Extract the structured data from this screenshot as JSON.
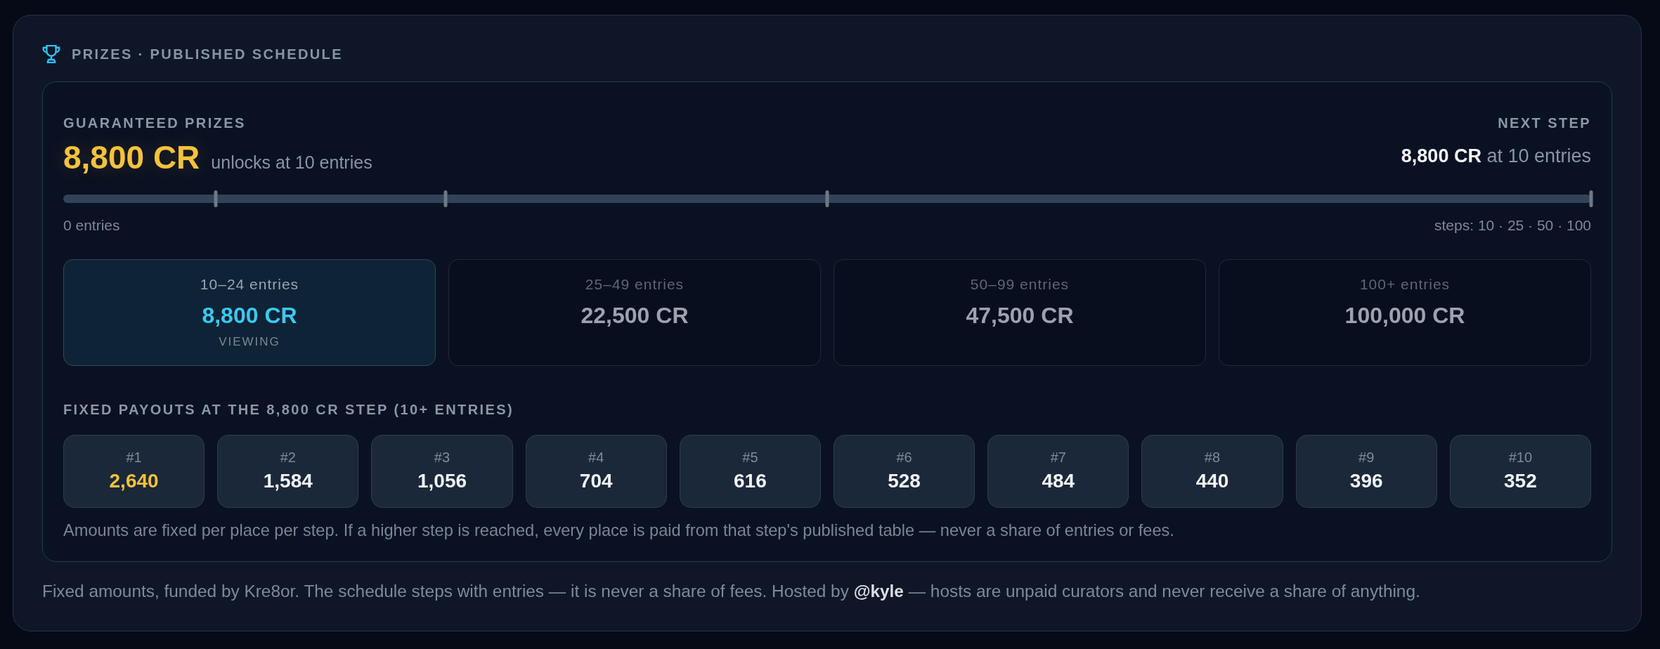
{
  "header": {
    "title": "PRIZES · PUBLISHED SCHEDULE"
  },
  "guaranteed": {
    "label": "GUARANTEED PRIZES",
    "amount": "8,800 CR",
    "note": "unlocks at 10 entries"
  },
  "next_step": {
    "label": "NEXT STEP",
    "text": "**8,800 CR** at 10 entries"
  },
  "progress": {
    "markers": [
      {
        "level": 0.1
      },
      {
        "level": 0.25
      },
      {
        "level": 0.5
      },
      {
        "level": 1
      }
    ],
    "start_label": "0 entries",
    "steps_label": "steps: 10 · 25 · 50 · 100"
  },
  "tiers": [
    {
      "range": "10–24 entries",
      "amount": "8,800 CR",
      "selected": true,
      "badge": "VIEWING"
    },
    {
      "range": "25–49 entries",
      "amount": "22,500 CR",
      "selected": false
    },
    {
      "range": "50–99 entries",
      "amount": "47,500 CR",
      "selected": false
    },
    {
      "range": "100+ entries",
      "amount": "100,000 CR",
      "selected": false
    }
  ],
  "payouts": {
    "title": "FIXED PAYOUTS AT THE 8,800 CR STEP (10+ ENTRIES)",
    "places": [
      {
        "place": "#1",
        "amount": "2,640",
        "highlighted": true
      },
      {
        "place": "#2",
        "amount": "1,584",
        "highlighted": false
      },
      {
        "place": "#3",
        "amount": "1,056",
        "highlighted": false
      },
      {
        "place": "#4",
        "amount": "704",
        "highlighted": false
      },
      {
        "place": "#5",
        "amount": "616",
        "highlighted": false
      },
      {
        "place": "#6",
        "amount": "528",
        "highlighted": false
      },
      {
        "place": "#7",
        "amount": "484",
        "highlighted": false
      },
      {
        "place": "#8",
        "amount": "440",
        "highlighted": false
      },
      {
        "place": "#9",
        "amount": "396",
        "highlighted": false
      },
      {
        "place": "#10",
        "amount": "352",
        "highlighted": false
      }
    ],
    "note": "Amounts are fixed per place per step. If a higher step is reached, every place is paid from that step's published table — never a share of entries or fees."
  },
  "footer": "Fixed amounts, funded by Kre8or. The schedule steps with entries — it is never a share of fees. Hosted by **@kyle** — hosts are unpaid curators and never receive a share of anything."
}
